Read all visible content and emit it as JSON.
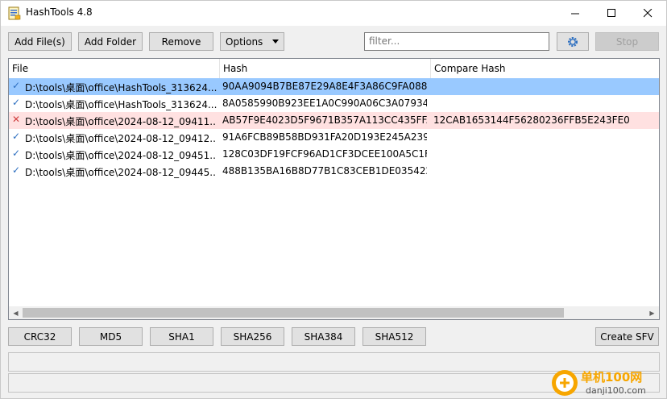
{
  "window": {
    "title": "HashTools 4.8"
  },
  "toolbar": {
    "add_files": "Add File(s)",
    "add_folder": "Add Folder",
    "remove": "Remove",
    "options": "Options",
    "filter_placeholder": "filter...",
    "stop": "Stop"
  },
  "table": {
    "columns": [
      "File",
      "Hash",
      "Compare Hash"
    ],
    "rows": [
      {
        "status": "ok",
        "file": "D:\\tools\\桌面\\office\\HashTools_313624...",
        "hash": "90AA9094B7BE87E29A8E4F3A86C9FA088...",
        "compare": ""
      },
      {
        "status": "ok",
        "file": "D:\\tools\\桌面\\office\\HashTools_313624...",
        "hash": "8A0585990B923EE1A0C990A06C3A07934...",
        "compare": ""
      },
      {
        "status": "mismatch",
        "file": "D:\\tools\\桌面\\office\\2024-08-12_09411...",
        "hash": "AB57F9E4023D5F9671B357A113CC435FFA...",
        "compare": "12CAB1653144F56280236FFB5E243FE0"
      },
      {
        "status": "ok",
        "file": "D:\\tools\\桌面\\office\\2024-08-12_09412...",
        "hash": "91A6FCB89B58BD931FA20D193E245A239...",
        "compare": ""
      },
      {
        "status": "ok",
        "file": "D:\\tools\\桌面\\office\\2024-08-12_09451...",
        "hash": "128C03DF19FCF96AD1CF3DCEE100A5C1F...",
        "compare": ""
      },
      {
        "status": "ok",
        "file": "D:\\tools\\桌面\\office\\2024-08-12_09445...",
        "hash": "488B135BA16B8D77B1C83CEB1DE035422...",
        "compare": ""
      }
    ]
  },
  "algorithms": [
    "CRC32",
    "MD5",
    "SHA1",
    "SHA256",
    "SHA384",
    "SHA512"
  ],
  "create_sfv": "Create SFV",
  "watermark": {
    "brand": "单机100网",
    "url": "danji100.com"
  },
  "colors": {
    "selected_row": "#99c9ff",
    "mismatch_row": "#ffe1e1",
    "accent": "#2d6fc0"
  }
}
